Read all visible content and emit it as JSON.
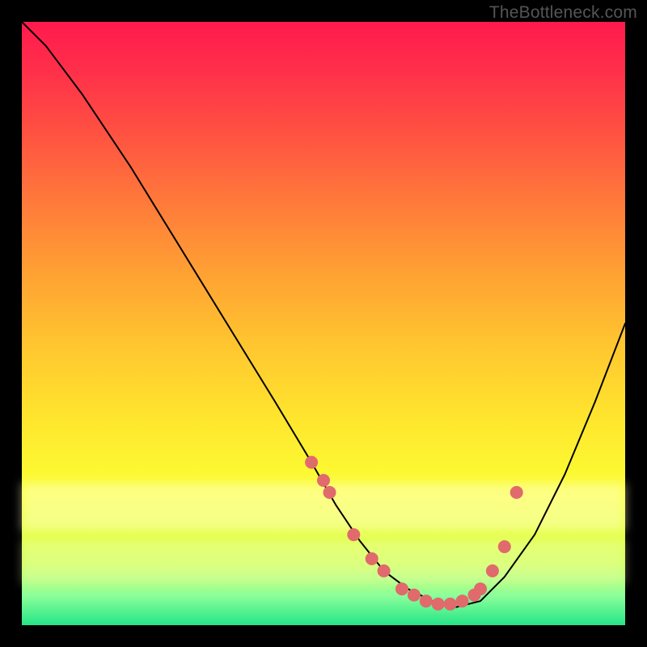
{
  "watermark": "TheBottleneck.com",
  "colors": {
    "background": "#000000",
    "marker": "#e06a6c",
    "line": "#000000",
    "gradient_top": "#ff1a4d",
    "gradient_bottom": "#25e588"
  },
  "chart_data": {
    "type": "line",
    "title": "",
    "xlabel": "",
    "ylabel": "",
    "xlim": [
      0,
      100
    ],
    "ylim": [
      0,
      100
    ],
    "x": [
      0,
      4,
      10,
      18,
      26,
      34,
      42,
      48,
      52,
      56,
      60,
      64,
      68,
      72,
      76,
      80,
      85,
      90,
      95,
      100
    ],
    "y": [
      100,
      96,
      88,
      76,
      63,
      50,
      37,
      27,
      20,
      14,
      9,
      6,
      4,
      3,
      4,
      8,
      15,
      25,
      37,
      50
    ],
    "markers": {
      "x": [
        48,
        50,
        51,
        55,
        58,
        60,
        63,
        65,
        67,
        69,
        71,
        73,
        75,
        76,
        78,
        80,
        82
      ],
      "y": [
        27,
        24,
        22,
        15,
        11,
        9,
        6,
        5,
        4,
        3.5,
        3.5,
        4,
        5,
        6,
        9,
        13,
        22
      ]
    },
    "annotations": []
  }
}
